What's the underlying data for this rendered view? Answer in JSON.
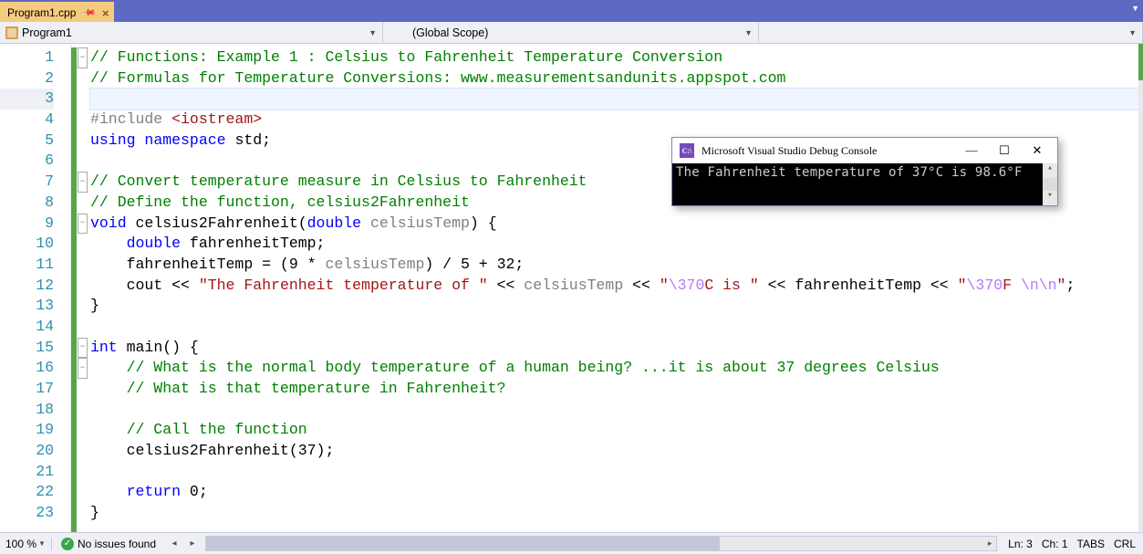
{
  "tab": {
    "name": "Program1.cpp"
  },
  "navbar": {
    "left": "Program1",
    "scope": "(Global Scope)",
    "right": ""
  },
  "code": {
    "lines": [
      {
        "t": "comment",
        "s": "// Functions: Example 1 : Celsius to Fahrenheit Temperature Conversion",
        "fold": "-"
      },
      {
        "t": "comment",
        "s": "// Formulas for Temperature Conversions: www.measurementsandunits.appspot.com"
      },
      {
        "t": "blank",
        "s": ""
      },
      {
        "t": "include",
        "s": "#include <iostream>"
      },
      {
        "t": "using",
        "s": "using namespace std;"
      },
      {
        "t": "blank",
        "s": ""
      },
      {
        "t": "comment",
        "s": "// Convert temperature measure in Celsius to Fahrenheit",
        "fold": "-"
      },
      {
        "t": "comment",
        "s": "// Define the function, celsius2Fahrenheit"
      },
      {
        "t": "funcdef",
        "s": "void celsius2Fahrenheit(double celsiusTemp) {",
        "fold": "-"
      },
      {
        "t": "decl",
        "s": "    double fahrenheitTemp;"
      },
      {
        "t": "assign",
        "s": "    fahrenheitTemp = (9 * celsiusTemp) / 5 + 32;"
      },
      {
        "t": "cout",
        "s": "    cout << \"The Fahrenheit temperature of \" << celsiusTemp << \"\\370C is \" << fahrenheitTemp << \"\\370F \\n\\n\";"
      },
      {
        "t": "plain",
        "s": "}"
      },
      {
        "t": "blank",
        "s": ""
      },
      {
        "t": "main",
        "s": "int main() {",
        "fold": "-"
      },
      {
        "t": "comment",
        "s": "    // What is the normal body temperature of a human being? ...it is about 37 degrees Celsius",
        "fold": "-"
      },
      {
        "t": "comment",
        "s": "    // What is that temperature in Fahrenheit?"
      },
      {
        "t": "blank",
        "s": ""
      },
      {
        "t": "comment",
        "s": "    // Call the function"
      },
      {
        "t": "plain",
        "s": "    celsius2Fahrenheit(37);"
      },
      {
        "t": "blank",
        "s": ""
      },
      {
        "t": "return",
        "s": "    return 0;"
      },
      {
        "t": "plain",
        "s": "}"
      }
    ],
    "current_line": 3
  },
  "console": {
    "title": "Microsoft Visual Studio Debug Console",
    "icon": "C:\\",
    "output": "The Fahrenheit temperature of 37°C is 98.6°F"
  },
  "status": {
    "zoom": "100 %",
    "issues": "No issues found",
    "line": "Ln: 3",
    "col": "Ch: 1",
    "tabs": "TABS",
    "crlf": "CRL"
  }
}
